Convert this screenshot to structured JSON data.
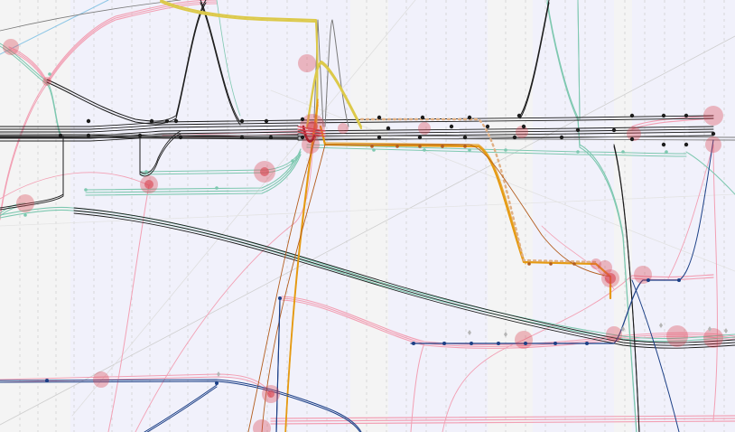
{
  "canvas": {
    "background": "#f4f4f4",
    "band_color": "#f1f1fb",
    "grid_color": "#d8d8d8",
    "guide_color": "#cfcfcf"
  },
  "palette": {
    "black": "#1c1c1c",
    "gray": "#7a7a7a",
    "teal": "#7ec8b0",
    "pink": "#f2a0b4",
    "red": "#d9434f",
    "navy": "#1b3f86",
    "yellow": "#dcc94a",
    "orange": "#e59a12",
    "brown": "#b35d1e",
    "light_blue": "#8cc6e6",
    "dark_red": "#8b0a14",
    "gold_dots": "#e0b084"
  },
  "icons": {
    "marker": "circle-marker-icon",
    "hotspot": "highlight-blob-icon",
    "diamond": "diamond-marker-icon"
  }
}
